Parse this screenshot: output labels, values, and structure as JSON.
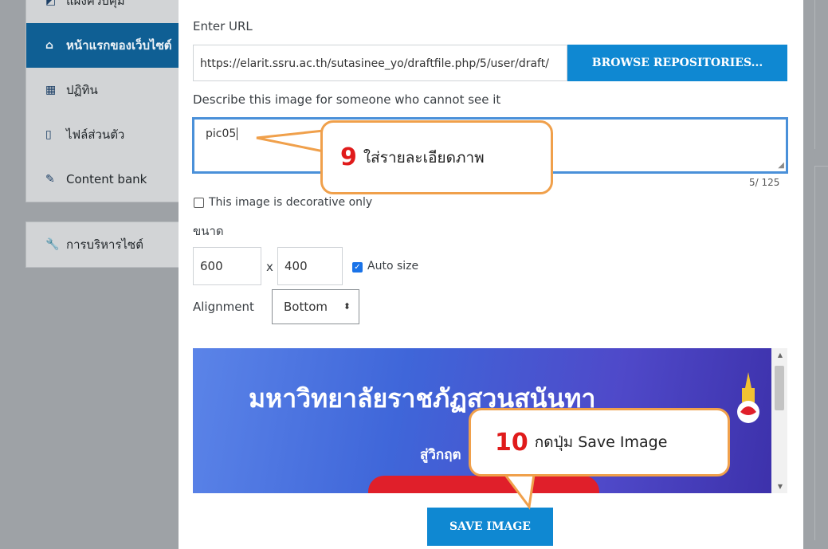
{
  "nav": {
    "items": [
      {
        "label": "แผงควบคุม",
        "icon": "dashboard-icon",
        "glyph": "◩"
      },
      {
        "label": "หน้าแรกของเว็บไซต์",
        "icon": "home-icon",
        "glyph": "⌂",
        "active": true
      },
      {
        "label": "ปฏิทิน",
        "icon": "calendar-icon",
        "glyph": "▦"
      },
      {
        "label": "ไฟล์ส่วนตัว",
        "icon": "file-icon",
        "glyph": "▯"
      },
      {
        "label": "Content bank",
        "icon": "paintbrush-icon",
        "glyph": "✎"
      },
      {
        "label": "การบริหารไซต์",
        "icon": "wrench-icon",
        "glyph": "🔧"
      }
    ]
  },
  "dialog": {
    "enter_url_label": "Enter URL",
    "url_value": "https://elarit.ssru.ac.th/sutasinee_yo/draftfile.php/5/user/draft/",
    "browse_label": "BROWSE REPOSITORIES...",
    "describe_label": "Describe this image for someone who cannot see it",
    "alt_text": "pic05",
    "char_count": "5/ 125",
    "decorative_label": "This image is decorative only",
    "decorative_checked": false,
    "size_label": "ขนาด",
    "width_value": "600",
    "x_sep": "x",
    "height_value": "400",
    "auto_size_label": "Auto size",
    "auto_size_checked": true,
    "alignment_label": "Alignment",
    "alignment_value": "Bottom",
    "save_label": "SAVE IMAGE"
  },
  "preview": {
    "title": "มหาวิทยาลัยราชภัฏสวนสุนันทา",
    "subtitle": "สู่วิกฤต"
  },
  "callouts": {
    "step9_num": "9",
    "step9_text": "ใส่รายละเอียดภาพ",
    "step10_num": "10",
    "step10_text": "กดปุ่ม Save Image"
  },
  "colors": {
    "accent": "#0f88d2",
    "active_nav": "#0f5f94",
    "callout_border": "#f0a04b",
    "step_number": "#e01b1b"
  }
}
